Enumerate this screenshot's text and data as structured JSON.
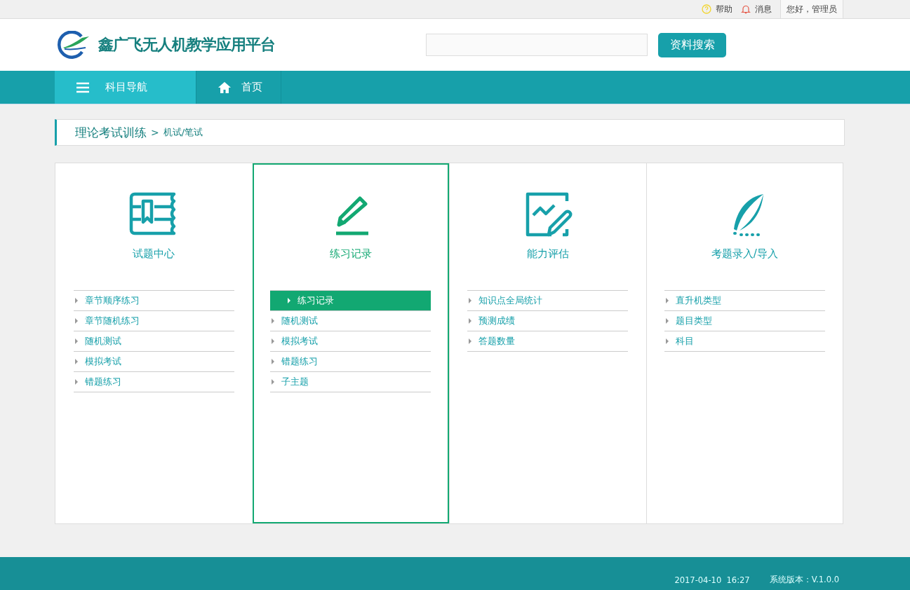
{
  "top_bar": {
    "help": "帮助",
    "messages": "消息",
    "greeting": "您好，管理员"
  },
  "header": {
    "logo_text": "鑫广飞无人机教学应用平台",
    "search_button": "资料搜索"
  },
  "nav": {
    "items": [
      {
        "kind": "menu",
        "label": "科目导航",
        "selected": true
      },
      {
        "kind": "home",
        "label": "首页",
        "selected": false
      }
    ]
  },
  "breadcrumb": {
    "section": "理论考试训练",
    "separator": ">",
    "page": "机试/笔试"
  },
  "cards": [
    {
      "kind": "book",
      "title": "试题中心",
      "selected": false,
      "items": [
        {
          "label": "章节顺序练习",
          "selected": false
        },
        {
          "label": "章节随机练习",
          "selected": false
        },
        {
          "label": "随机测试",
          "selected": false
        },
        {
          "label": "模拟考试",
          "selected": false
        },
        {
          "label": "错题练习",
          "selected": false
        }
      ]
    },
    {
      "kind": "pencil",
      "title": "练习记录",
      "selected": true,
      "items": [
        {
          "label": "练习记录",
          "selected": true
        },
        {
          "label": "随机测试",
          "selected": false
        },
        {
          "label": "模拟考试",
          "selected": false
        },
        {
          "label": "错题练习",
          "selected": false
        },
        {
          "label": "子主题",
          "selected": false
        }
      ]
    },
    {
      "kind": "chart",
      "title": "能力评估",
      "selected": false,
      "items": [
        {
          "label": "知识点全局统计",
          "selected": false
        },
        {
          "label": "预测成绩",
          "selected": false
        },
        {
          "label": "答题数量",
          "selected": false
        }
      ]
    },
    {
      "kind": "feather",
      "title": "考题录入/导入",
      "selected": false,
      "items": [
        {
          "label": "直升机类型",
          "selected": false
        },
        {
          "label": "题目类型",
          "selected": false
        },
        {
          "label": "科目",
          "selected": false
        }
      ]
    }
  ],
  "footer": {
    "datetime": "2017-04-10  16:27",
    "version": "系统版本：V.1.0.0"
  }
}
